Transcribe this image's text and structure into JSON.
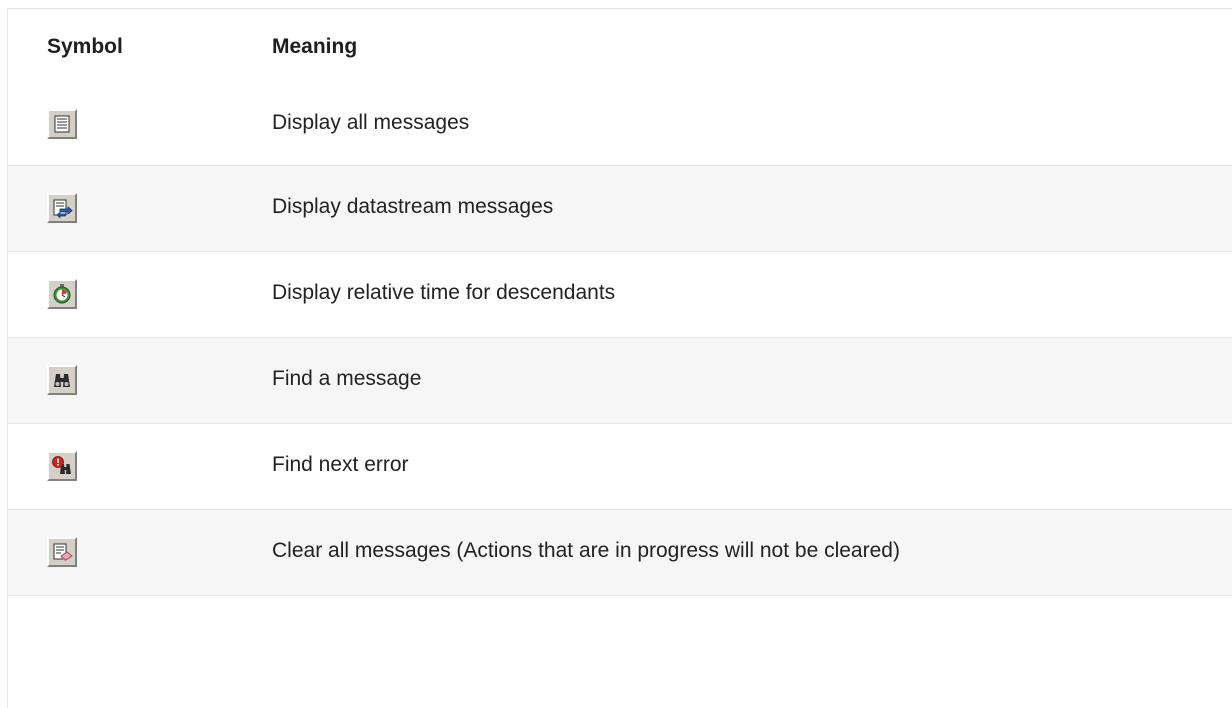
{
  "table": {
    "headers": {
      "symbol": "Symbol",
      "meaning": "Meaning"
    },
    "rows": [
      {
        "icon": "display-all-messages-icon",
        "meaning": "Display all messages"
      },
      {
        "icon": "display-datastream-messages-icon",
        "meaning": "Display datastream messages"
      },
      {
        "icon": "relative-time-descendants-icon",
        "meaning": "Display relative time for descendants"
      },
      {
        "icon": "find-message-icon",
        "meaning": "Find a message"
      },
      {
        "icon": "find-next-error-icon",
        "meaning": "Find next error"
      },
      {
        "icon": "clear-all-messages-icon",
        "meaning": "Clear all messages (Actions that are in progress will not be cleared)"
      }
    ]
  },
  "colors": {
    "header_text": "#1e1e1e",
    "stripe": "#f6f6f6",
    "row_divider": "#e6e6e6",
    "button_face": "#d4d0c8"
  }
}
